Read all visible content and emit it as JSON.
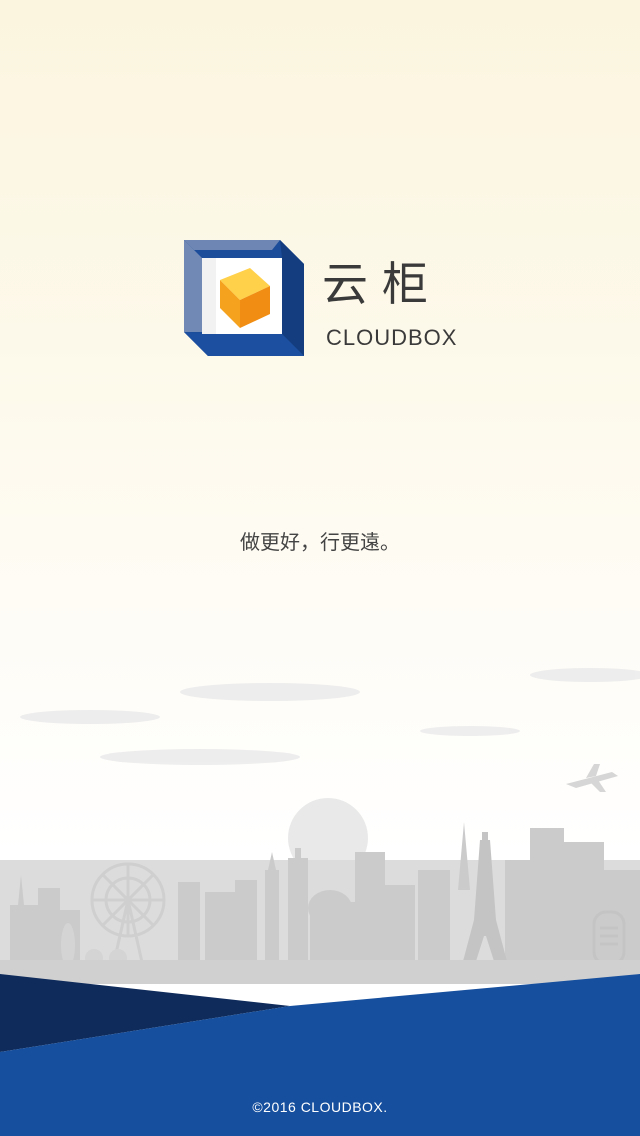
{
  "brand": {
    "name_cn": "云柜",
    "name_en": "CLOUDBOX"
  },
  "slogan": "做更好，行更遠。",
  "footer": {
    "copyright": "©2016 CLOUDBOX."
  },
  "colors": {
    "primary_blue": "#1a4f9c",
    "navy": "#0f2a5a",
    "cube_orange": "#f6a623",
    "skyline_gray": "#c9c9c9"
  },
  "icons": {
    "logo": "cloudbox-logo-icon",
    "airplane": "airplane-icon"
  }
}
